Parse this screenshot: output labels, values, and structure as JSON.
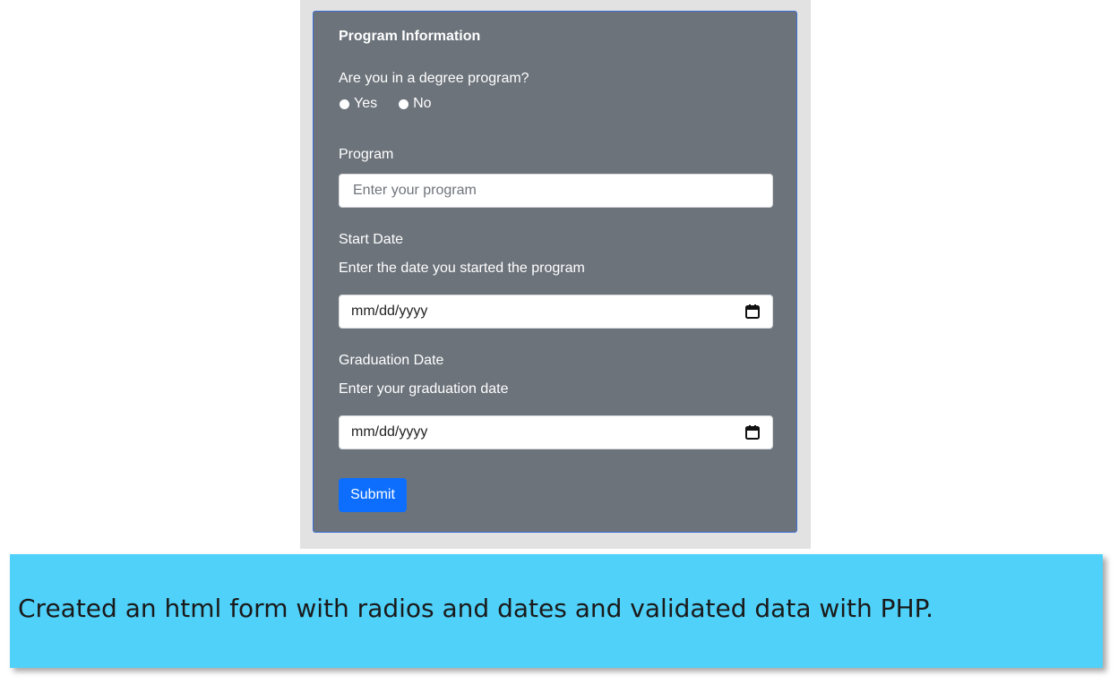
{
  "form": {
    "title": "Program Information",
    "degree_question": "Are you in a degree program?",
    "radios": [
      {
        "label": "Yes"
      },
      {
        "label": "No"
      }
    ],
    "program": {
      "label": "Program",
      "placeholder": "Enter your program",
      "value": ""
    },
    "start_date": {
      "label": "Start Date",
      "help": "Enter the date you started the program",
      "value": "mm/dd/yyyy"
    },
    "graduation_date": {
      "label": "Graduation Date",
      "help": "Enter your graduation date",
      "value": "mm/dd/yyyy"
    },
    "submit_label": "Submit"
  },
  "caption": "Created an html form with radios and dates and validated data with PHP.",
  "colors": {
    "card_bg": "#6c737b",
    "card_border": "#3d6fd6",
    "frame_bg": "#e2e2e2",
    "submit_bg": "#0d6efd",
    "banner_bg": "#4fd1fa"
  }
}
